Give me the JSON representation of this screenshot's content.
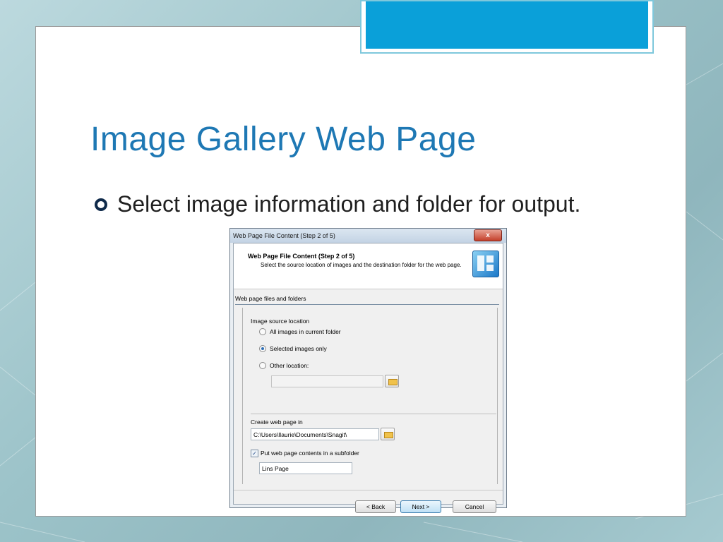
{
  "slide": {
    "title": "Image Gallery Web Page",
    "bullet": "Select image information and folder for output."
  },
  "dialog": {
    "window_title": "Web Page File Content (Step 2 of 5)",
    "close_label": "x",
    "header_title": "Web Page File Content (Step 2 of 5)",
    "header_desc": "Select the source location of images and the destination folder for the web page.",
    "section_label": "Web page files and folders",
    "source_label": "Image source location",
    "radio_options": [
      {
        "label": "All images in current folder",
        "selected": false
      },
      {
        "label": "Selected images only",
        "selected": true
      },
      {
        "label": "Other location:",
        "selected": false
      }
    ],
    "other_location_value": "",
    "create_label": "Create web page in",
    "create_path": "C:\\Users\\llaurie\\Documents\\Snagit\\",
    "subfolder_checkbox_label": "Put web page contents in a subfolder",
    "subfolder_checked": true,
    "subfolder_name": "Lins Page",
    "buttons": {
      "back": "< Back",
      "next": "Next >",
      "cancel": "Cancel"
    }
  },
  "colors": {
    "title": "#1e78b4",
    "accent": "#0aa0d9",
    "background": "#9cc3c9"
  }
}
